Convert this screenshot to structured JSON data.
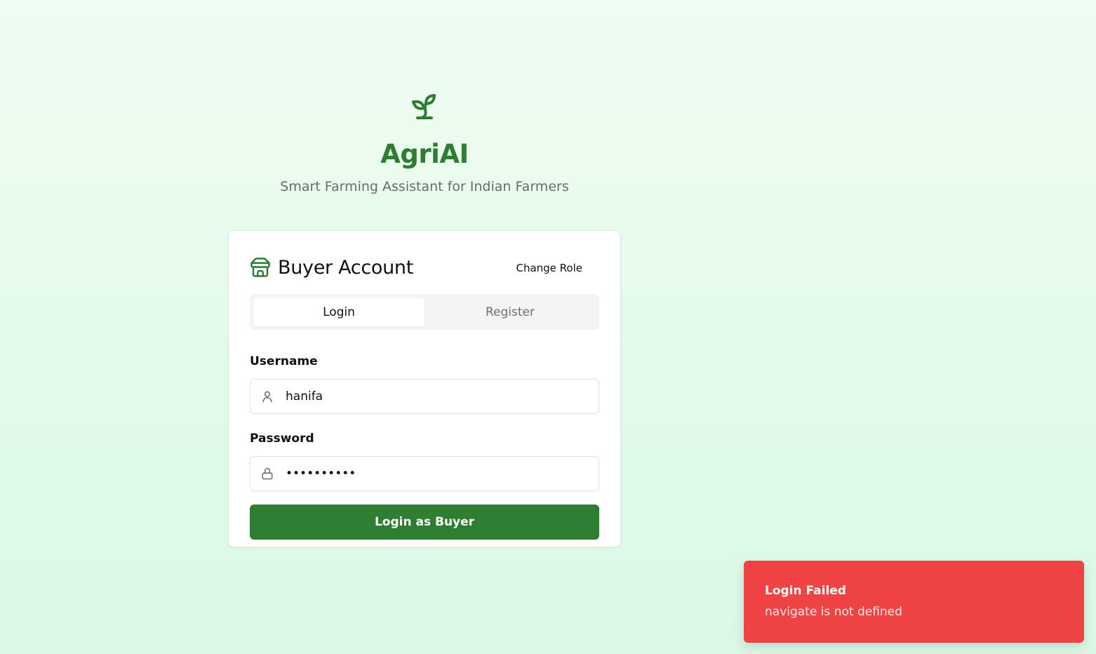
{
  "brand": {
    "name": "AgriAI",
    "tagline": "Smart Farming Assistant for Indian Farmers",
    "accent": "#2e7d32"
  },
  "card": {
    "icon": "store-icon",
    "title": "Buyer Account",
    "change_role_label": "Change Role"
  },
  "tabs": [
    {
      "label": "Login",
      "active": true
    },
    {
      "label": "Register",
      "active": false
    }
  ],
  "form": {
    "username_label": "Username",
    "username_value": "hanifa",
    "username_icon": "user-icon",
    "password_label": "Password",
    "password_value": "••••••••••",
    "password_icon": "lock-icon",
    "submit_label": "Login as Buyer"
  },
  "toast": {
    "title": "Login Failed",
    "description": "navigate is not defined",
    "color": "#ef4444"
  }
}
